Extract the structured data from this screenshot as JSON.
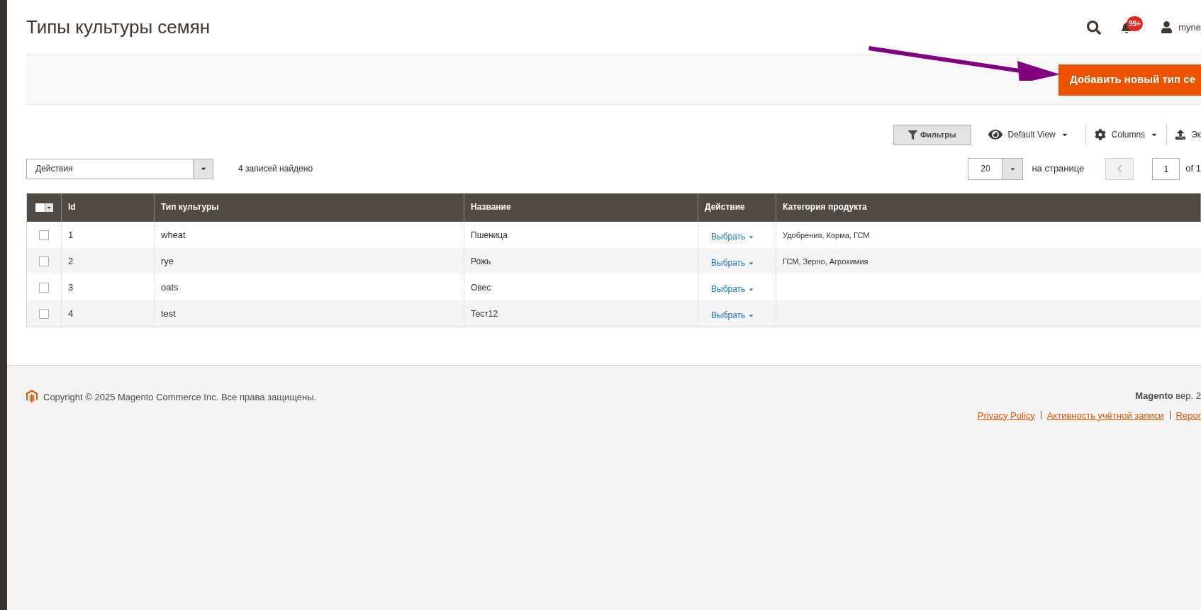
{
  "page_title": "Типы культуры семян",
  "header": {
    "notifications_badge": "99+",
    "user_name": "myne"
  },
  "add_button": "Добавить новый тип се",
  "toolbar": {
    "filters": "Фильтры",
    "view": "Default View",
    "columns": "Columns",
    "export": "Эк"
  },
  "actions_select": "Действия",
  "records_found": "4 записей найдено",
  "pagination": {
    "per_page": "20",
    "per_page_label": "на странице",
    "page": "1",
    "of_pages": "of 1"
  },
  "table": {
    "columns": [
      "Id",
      "Тип культуры",
      "Название",
      "Действие",
      "Категория продукта"
    ],
    "rows": [
      {
        "id": "1",
        "culture_type": "wheat",
        "name": "Пшеница",
        "action": "Выбрать",
        "category": "Удобрения, Корма, ГСМ",
        "checked": false
      },
      {
        "id": "2",
        "culture_type": "rye",
        "name": "Рожь",
        "action": "Выбрать",
        "category": "ГСМ, Зерно, Агрохимия",
        "checked": false
      },
      {
        "id": "3",
        "culture_type": "oats",
        "name": "Овес",
        "action": "Выбрать",
        "category": "",
        "checked": false
      },
      {
        "id": "4",
        "culture_type": "test",
        "name": "Тест12",
        "action": "Выбрать",
        "category": "",
        "checked": false
      }
    ]
  },
  "footer": {
    "copyright": "Copyright © 2025 Magento Commerce Inc. Все права защищены.",
    "version": "**Magento** вер. 2",
    "links": [
      "Privacy Policy",
      "Активность учётной записи",
      "Repor"
    ]
  }
}
